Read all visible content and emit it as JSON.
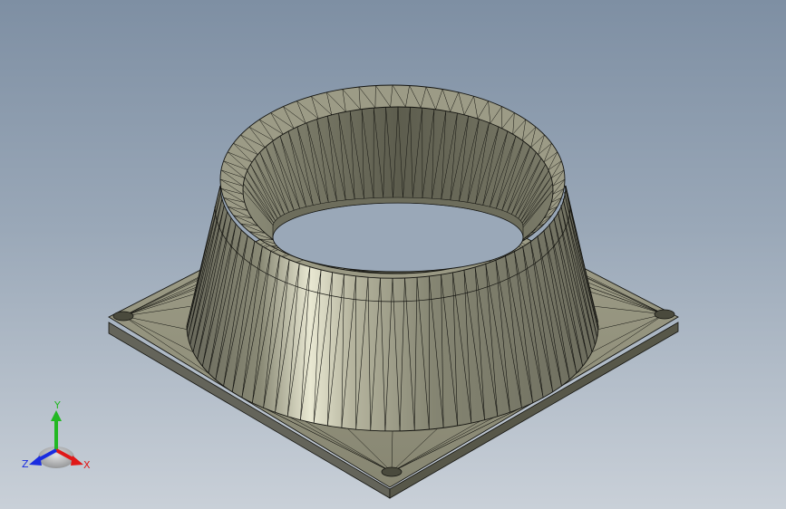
{
  "viewport": {
    "shading": "shaded-with-edges",
    "colors": {
      "background_top": "#7e8fa3",
      "background_bottom": "#c9d0d8",
      "part_fill": "#8a8a74",
      "part_dark": "#545443",
      "part_highlight": "#f1f0dc",
      "edge": "#141410"
    }
  },
  "triad": {
    "y_label": "Y",
    "z_label": "Z",
    "x_label": "X",
    "colors": {
      "x": "#e01818",
      "y": "#22b822",
      "z": "#1a2ce0"
    }
  }
}
